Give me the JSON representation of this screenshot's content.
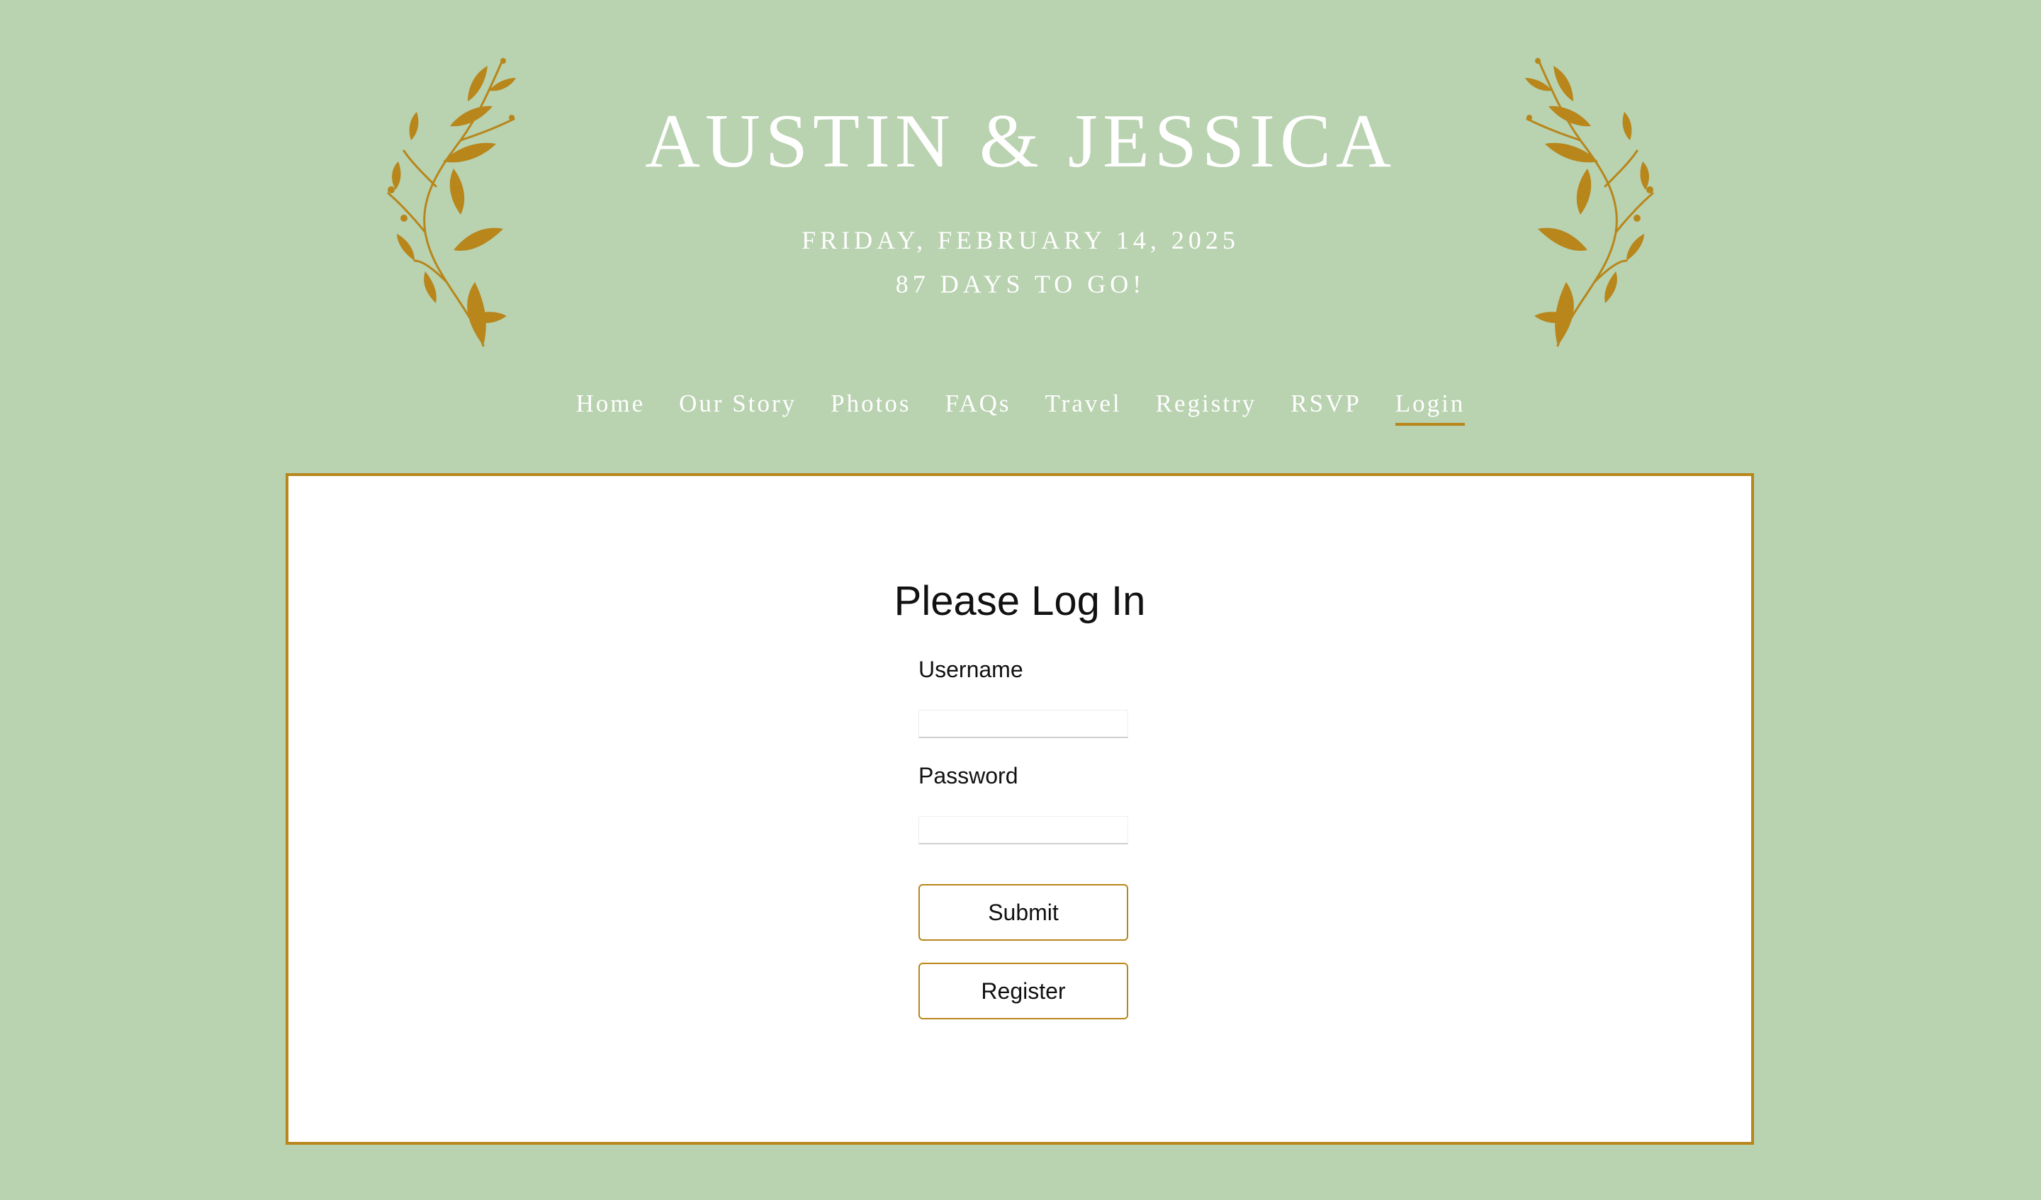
{
  "header": {
    "title": "AUSTIN & JESSICA",
    "date": "FRIDAY, FEBRUARY 14, 2025",
    "countdown": "87 DAYS TO GO!"
  },
  "nav": {
    "items": [
      {
        "label": "Home",
        "active": false
      },
      {
        "label": "Our Story",
        "active": false
      },
      {
        "label": "Photos",
        "active": false
      },
      {
        "label": "FAQs",
        "active": false
      },
      {
        "label": "Travel",
        "active": false
      },
      {
        "label": "Registry",
        "active": false
      },
      {
        "label": "RSVP",
        "active": false
      },
      {
        "label": "Login",
        "active": true
      }
    ]
  },
  "login": {
    "heading": "Please Log In",
    "username_label": "Username",
    "username_value": "",
    "password_label": "Password",
    "password_value": "",
    "submit_label": "Submit",
    "register_label": "Register"
  },
  "colors": {
    "background": "#b9d2b0",
    "accent_gold": "#b8861a",
    "card": "#ffffff",
    "header_text": "#ffffff"
  },
  "icons": {
    "decoration_left": "leaf-vine-icon",
    "decoration_right": "leaf-vine-icon"
  }
}
